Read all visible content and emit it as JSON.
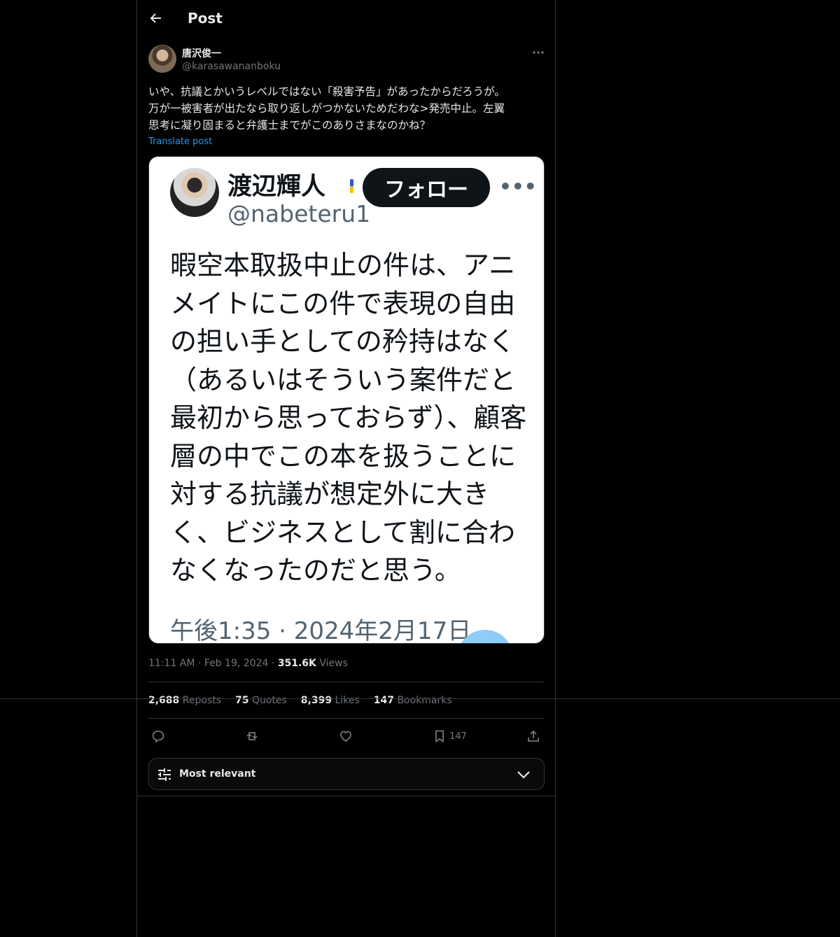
{
  "header": {
    "title": "Post"
  },
  "author": {
    "name": "唐沢俊一",
    "handle": "@karasawananboku"
  },
  "post": {
    "text": "いや、抗議とかいうレベルではない「殺害予告」があったからだろうが。\n万が一被害者が出たなら取り返しがつかないためだわな>発売中止。左翼\n思考に凝り固まると弁護士までがこのありさまなのかね？",
    "translate_label": "Translate post"
  },
  "media": {
    "name": "渡辺輝人",
    "handle": "@nabeteru1",
    "follow_label": "フォロー",
    "body": "暇空本取扱中止の件は、アニメイトにこの件で表現の自由の担い手としての矜持はなく（あるいはそういう案件だと最初から思っておらず）、顧客層の中でこの本を扱うことに対する抗議が想定外に大きく、ビジネスとして割に合わなくなったのだと思う。",
    "date": "午後1:35 · 2024年2月17日"
  },
  "meta": {
    "time": "11:11 AM",
    "date": "Feb 19, 2024",
    "views_count": "351.6K",
    "views_label": "Views"
  },
  "stats": [
    {
      "count": "2,688",
      "label": "Reposts"
    },
    {
      "count": "75",
      "label": "Quotes"
    },
    {
      "count": "8,399",
      "label": "Likes"
    },
    {
      "count": "147",
      "label": "Bookmarks"
    }
  ],
  "actions": {
    "bookmark_count": "147"
  },
  "sort": {
    "label": "Most relevant"
  }
}
